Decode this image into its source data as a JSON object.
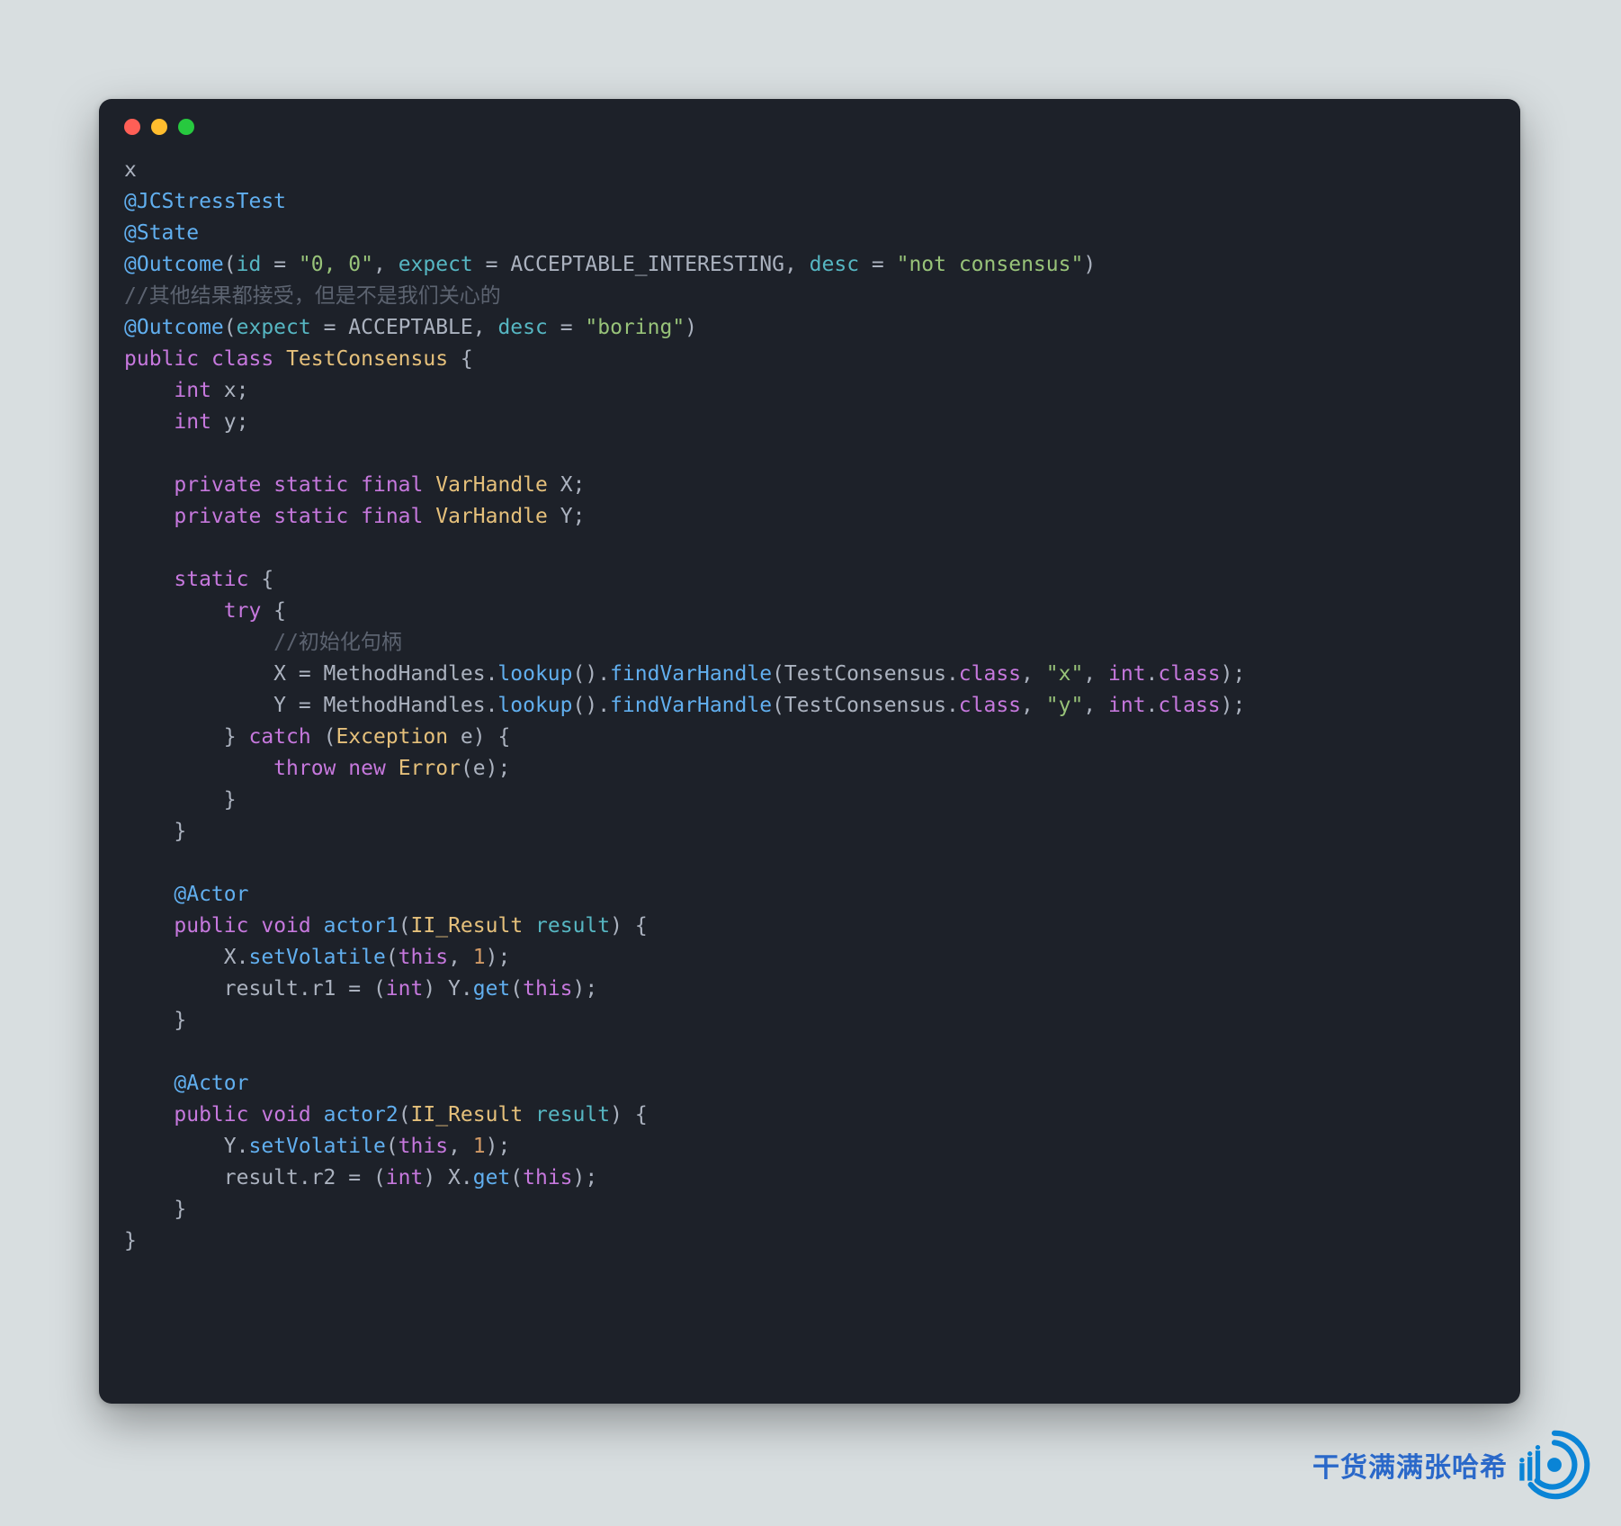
{
  "window": {
    "traffic_lights": [
      "close",
      "minimize",
      "zoom"
    ]
  },
  "code": {
    "tokens": [
      [
        [
          "plain",
          "x"
        ]
      ],
      [
        [
          "blue",
          "@JCStressTest"
        ]
      ],
      [
        [
          "blue",
          "@State"
        ]
      ],
      [
        [
          "blue",
          "@Outcome"
        ],
        [
          "plain",
          "("
        ],
        [
          "cyan",
          "id"
        ],
        [
          "plain",
          " = "
        ],
        [
          "green",
          "\"0, 0\""
        ],
        [
          "plain",
          ", "
        ],
        [
          "cyan",
          "expect"
        ],
        [
          "plain",
          " = ACCEPTABLE_INTERESTING, "
        ],
        [
          "cyan",
          "desc"
        ],
        [
          "plain",
          " = "
        ],
        [
          "green",
          "\"not consensus\""
        ],
        [
          "plain",
          ")"
        ]
      ],
      [
        [
          "comment",
          "//其他结果都接受，但是不是我们关心的"
        ]
      ],
      [
        [
          "blue",
          "@Outcome"
        ],
        [
          "plain",
          "("
        ],
        [
          "cyan",
          "expect"
        ],
        [
          "plain",
          " = ACCEPTABLE, "
        ],
        [
          "cyan",
          "desc"
        ],
        [
          "plain",
          " = "
        ],
        [
          "green",
          "\"boring\""
        ],
        [
          "plain",
          ")"
        ]
      ],
      [
        [
          "purple",
          "public"
        ],
        [
          "plain",
          " "
        ],
        [
          "purple",
          "class"
        ],
        [
          "plain",
          " "
        ],
        [
          "yellow",
          "TestConsensus"
        ],
        [
          "plain",
          " {"
        ]
      ],
      [
        [
          "plain",
          "    "
        ],
        [
          "purple",
          "int"
        ],
        [
          "plain",
          " x;"
        ]
      ],
      [
        [
          "plain",
          "    "
        ],
        [
          "purple",
          "int"
        ],
        [
          "plain",
          " y;"
        ]
      ],
      [
        [
          "plain",
          ""
        ]
      ],
      [
        [
          "plain",
          "    "
        ],
        [
          "purple",
          "private"
        ],
        [
          "plain",
          " "
        ],
        [
          "purple",
          "static"
        ],
        [
          "plain",
          " "
        ],
        [
          "purple",
          "final"
        ],
        [
          "plain",
          " "
        ],
        [
          "yellow",
          "VarHandle"
        ],
        [
          "plain",
          " X;"
        ]
      ],
      [
        [
          "plain",
          "    "
        ],
        [
          "purple",
          "private"
        ],
        [
          "plain",
          " "
        ],
        [
          "purple",
          "static"
        ],
        [
          "plain",
          " "
        ],
        [
          "purple",
          "final"
        ],
        [
          "plain",
          " "
        ],
        [
          "yellow",
          "VarHandle"
        ],
        [
          "plain",
          " Y;"
        ]
      ],
      [
        [
          "plain",
          ""
        ]
      ],
      [
        [
          "plain",
          "    "
        ],
        [
          "purple",
          "static"
        ],
        [
          "plain",
          " {"
        ]
      ],
      [
        [
          "plain",
          "        "
        ],
        [
          "purple",
          "try"
        ],
        [
          "plain",
          " {"
        ]
      ],
      [
        [
          "plain",
          "            "
        ],
        [
          "comment",
          "//初始化句柄"
        ]
      ],
      [
        [
          "plain",
          "            X = MethodHandles."
        ],
        [
          "blue",
          "lookup"
        ],
        [
          "plain",
          "()."
        ],
        [
          "blue",
          "findVarHandle"
        ],
        [
          "plain",
          "(TestConsensus."
        ],
        [
          "purple",
          "class"
        ],
        [
          "plain",
          ", "
        ],
        [
          "green",
          "\"x\""
        ],
        [
          "plain",
          ", "
        ],
        [
          "purple",
          "int"
        ],
        [
          "plain",
          "."
        ],
        [
          "purple",
          "class"
        ],
        [
          "plain",
          ");"
        ]
      ],
      [
        [
          "plain",
          "            Y = MethodHandles."
        ],
        [
          "blue",
          "lookup"
        ],
        [
          "plain",
          "()."
        ],
        [
          "blue",
          "findVarHandle"
        ],
        [
          "plain",
          "(TestConsensus."
        ],
        [
          "purple",
          "class"
        ],
        [
          "plain",
          ", "
        ],
        [
          "green",
          "\"y\""
        ],
        [
          "plain",
          ", "
        ],
        [
          "purple",
          "int"
        ],
        [
          "plain",
          "."
        ],
        [
          "purple",
          "class"
        ],
        [
          "plain",
          ");"
        ]
      ],
      [
        [
          "plain",
          "        } "
        ],
        [
          "purple",
          "catch"
        ],
        [
          "plain",
          " ("
        ],
        [
          "yellow",
          "Exception"
        ],
        [
          "plain",
          " e) {"
        ]
      ],
      [
        [
          "plain",
          "            "
        ],
        [
          "purple",
          "throw"
        ],
        [
          "plain",
          " "
        ],
        [
          "purple",
          "new"
        ],
        [
          "plain",
          " "
        ],
        [
          "yellow",
          "Error"
        ],
        [
          "plain",
          "(e);"
        ]
      ],
      [
        [
          "plain",
          "        }"
        ]
      ],
      [
        [
          "plain",
          "    }"
        ]
      ],
      [
        [
          "plain",
          ""
        ]
      ],
      [
        [
          "plain",
          "    "
        ],
        [
          "blue",
          "@Actor"
        ]
      ],
      [
        [
          "plain",
          "    "
        ],
        [
          "purple",
          "public"
        ],
        [
          "plain",
          " "
        ],
        [
          "purple",
          "void"
        ],
        [
          "plain",
          " "
        ],
        [
          "blue",
          "actor1"
        ],
        [
          "plain",
          "("
        ],
        [
          "yellow",
          "II_Result"
        ],
        [
          "plain",
          " "
        ],
        [
          "cyan",
          "result"
        ],
        [
          "plain",
          ") {"
        ]
      ],
      [
        [
          "plain",
          "        X."
        ],
        [
          "blue",
          "setVolatile"
        ],
        [
          "plain",
          "("
        ],
        [
          "purple",
          "this"
        ],
        [
          "plain",
          ", "
        ],
        [
          "orange",
          "1"
        ],
        [
          "plain",
          ");"
        ]
      ],
      [
        [
          "plain",
          "        result.r1 = ("
        ],
        [
          "purple",
          "int"
        ],
        [
          "plain",
          ") Y."
        ],
        [
          "blue",
          "get"
        ],
        [
          "plain",
          "("
        ],
        [
          "purple",
          "this"
        ],
        [
          "plain",
          ");"
        ]
      ],
      [
        [
          "plain",
          "    }"
        ]
      ],
      [
        [
          "plain",
          ""
        ]
      ],
      [
        [
          "plain",
          "    "
        ],
        [
          "blue",
          "@Actor"
        ]
      ],
      [
        [
          "plain",
          "    "
        ],
        [
          "purple",
          "public"
        ],
        [
          "plain",
          " "
        ],
        [
          "purple",
          "void"
        ],
        [
          "plain",
          " "
        ],
        [
          "blue",
          "actor2"
        ],
        [
          "plain",
          "("
        ],
        [
          "yellow",
          "II_Result"
        ],
        [
          "plain",
          " "
        ],
        [
          "cyan",
          "result"
        ],
        [
          "plain",
          ") {"
        ]
      ],
      [
        [
          "plain",
          "        Y."
        ],
        [
          "blue",
          "setVolatile"
        ],
        [
          "plain",
          "("
        ],
        [
          "purple",
          "this"
        ],
        [
          "plain",
          ", "
        ],
        [
          "orange",
          "1"
        ],
        [
          "plain",
          ");"
        ]
      ],
      [
        [
          "plain",
          "        result.r2 = ("
        ],
        [
          "purple",
          "int"
        ],
        [
          "plain",
          ") X."
        ],
        [
          "blue",
          "get"
        ],
        [
          "plain",
          "("
        ],
        [
          "purple",
          "this"
        ],
        [
          "plain",
          ");"
        ]
      ],
      [
        [
          "plain",
          "    }"
        ]
      ],
      [
        [
          "plain",
          "}"
        ]
      ]
    ]
  },
  "watermark": {
    "text": "干货满满张哈希"
  },
  "colors": {
    "page_bg": "#d8dee0",
    "window_bg": "#1d2129",
    "traffic_red": "#ff5f56",
    "traffic_yellow": "#ffbd2e",
    "traffic_green": "#27c93f",
    "syntax_plain": "#abb2bf",
    "syntax_blue": "#61afef",
    "syntax_cyan": "#56b6c2",
    "syntax_green": "#98c379",
    "syntax_yellow": "#e5c07b",
    "syntax_orange": "#d19a66",
    "syntax_purple": "#c678dd",
    "syntax_comment": "#5c6370",
    "watermark_blue": "#2a68c9"
  }
}
